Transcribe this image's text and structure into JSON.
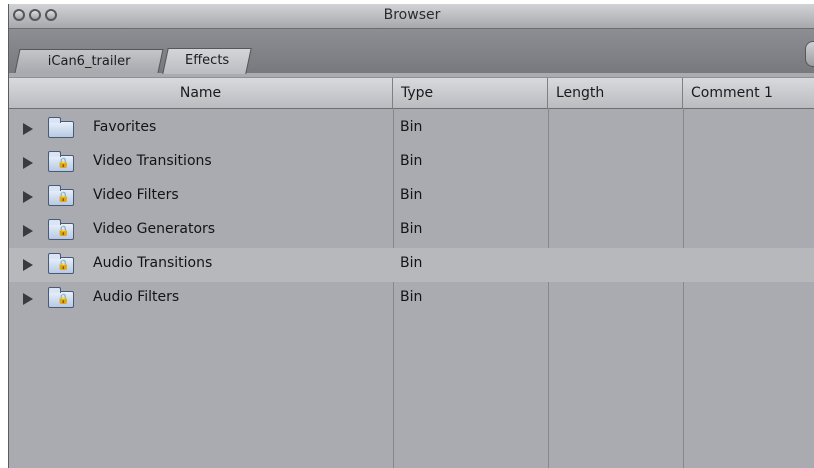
{
  "window": {
    "title": "Browser"
  },
  "tabs": [
    {
      "label": "iCan6_trailer",
      "active": false
    },
    {
      "label": "Effects",
      "active": true
    }
  ],
  "columns": {
    "name": "Name",
    "type": "Type",
    "length": "Length",
    "comment": "Comment 1"
  },
  "rows": [
    {
      "name": "Favorites",
      "type": "Bin",
      "icon": "folder-icon"
    },
    {
      "name": "Video Transitions",
      "type": "Bin",
      "icon": "locked-folder-icon"
    },
    {
      "name": "Video Filters",
      "type": "Bin",
      "icon": "locked-folder-icon"
    },
    {
      "name": "Video Generators",
      "type": "Bin",
      "icon": "locked-folder-icon"
    },
    {
      "name": "Audio Transitions",
      "type": "Bin",
      "icon": "locked-folder-icon",
      "highlighted": true
    },
    {
      "name": "Audio Filters",
      "type": "Bin",
      "icon": "locked-folder-icon"
    }
  ],
  "colors": {
    "panel": "#a9abb0",
    "highlight_row": "#b6b8bc",
    "folder": "#c9d8ee"
  }
}
